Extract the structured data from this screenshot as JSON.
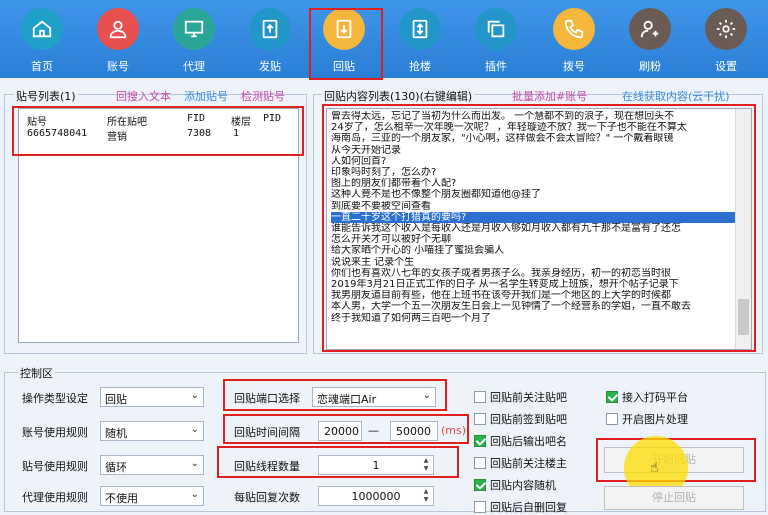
{
  "toolbar": {
    "items": [
      {
        "label": "首页",
        "icon": "home-icon",
        "color": "#1fa0c8"
      },
      {
        "label": "账号",
        "icon": "user-icon",
        "color": "#e85050"
      },
      {
        "label": "代理",
        "icon": "monitor-icon",
        "color": "#2aa59a"
      },
      {
        "label": "发贴",
        "icon": "upload-icon",
        "color": "#2296c8"
      },
      {
        "label": "回贴",
        "icon": "download-icon",
        "color": "#f4b63c"
      },
      {
        "label": "抢楼",
        "icon": "sort-icon",
        "color": "#2296c8"
      },
      {
        "label": "插件",
        "icon": "copy-icon",
        "color": "#2296c8"
      },
      {
        "label": "拨号",
        "icon": "phone-icon",
        "color": "#f4b63c"
      },
      {
        "label": "刷粉",
        "icon": "user-add-icon",
        "color": "#6b5b55"
      },
      {
        "label": "设置",
        "icon": "gear-icon",
        "color": "#6b5b55"
      }
    ]
  },
  "post_list": {
    "title": "贴号列表(1)",
    "import_text": "回搜入文本",
    "add_post": "添加贴号",
    "check_post": "检测贴号",
    "columns": [
      "贴号",
      "所在贴吧",
      "FID",
      "楼层",
      "PID"
    ],
    "rows": [
      [
        "6665748041",
        "营销",
        "7308",
        "1",
        ""
      ]
    ]
  },
  "reply_content": {
    "title": "回贴内容列表(130)(右键编辑)",
    "batch_add": "批量添加#账号",
    "online_fetch": "在线获取内容(云干扰)",
    "lines": [
      "曾去得太远，忘记了当初为什么而出发。 一个慧都不到的浪子，现在想回头不",
      "24岁了，怎么租辛一次年晚一次呢？ ，年轻璇迹不放？我一下子也不能在不算太",
      "海南岛，三亚的一个朋友家，\"小心啊，这样做会不会太冒险？\" 一个戴着眼镜",
      "从今天开始记录",
      "人如何回首?",
      "印象吗时刻了，怎么办?",
      "图上的朋友们都带着个人配?",
      "这种人竟不是也不像整个朋友圈都知道他@挂了",
      "到底要不要被空间查看",
      "一直二十岁这个打猎真的要吗?",
      "谁能告诉我这个收入是每收入还是月收入够如月收入都有九千那不是富有了还怎",
      "怎么开关才可以被好个无聊",
      "给大家晒个开心的 小喵挂了蜜挺会骗人",
      "说说来主 记录个生",
      "你们也有喜欢八七年的女孩子或者男孩子么。我亲身经历，初一的初恋当时很",
      "2019年3月21日正式工作的日子 从一名学生转变成上班族，想开个帖子记录下",
      "我男朋友道目前有些，他在上班书在该夸开我们是一个地区的上大学的时候都",
      "本人男，大学一个五一次朋友生日会上一见钟情了一个经营系的学姐，一直不敢去",
      "终于我知道了如何两三百吧一个月了"
    ],
    "selected_index": 9
  },
  "control": {
    "title": "控制区",
    "op_type_label": "操作类型设定",
    "op_type_value": "回贴",
    "account_rule_label": "账号使用规则",
    "account_rule_value": "随机",
    "post_rule_label": "贴号使用规则",
    "post_rule_value": "循环",
    "proxy_rule_label": "代理使用规则",
    "proxy_rule_value": "不使用",
    "port_label": "回贴端口选择",
    "port_value": "恋魂端口Air",
    "interval_label": "回贴时间间隔",
    "interval_min": "20000",
    "interval_dash": "—",
    "interval_max": "50000",
    "interval_unit": "(ms)",
    "threads_label": "回贴线程数量",
    "threads_value": "1",
    "repeat_label": "每贴回复次数",
    "repeat_value": "1000000",
    "checkboxes": [
      {
        "label": "回贴前关注贴吧",
        "checked": false
      },
      {
        "label": "回贴前签到贴吧",
        "checked": false
      },
      {
        "label": "回贴后输出吧名",
        "checked": true
      },
      {
        "label": "回贴前关注楼主",
        "checked": false
      },
      {
        "label": "回贴内容随机",
        "checked": true
      },
      {
        "label": "回贴后自删回复",
        "checked": false
      }
    ],
    "captcha_platform": {
      "label": "接入打码平台",
      "checked": true
    },
    "image_process": {
      "label": "开启图片处理",
      "checked": false
    },
    "start_button": "开始回贴",
    "stop_button": "停止回贴"
  }
}
